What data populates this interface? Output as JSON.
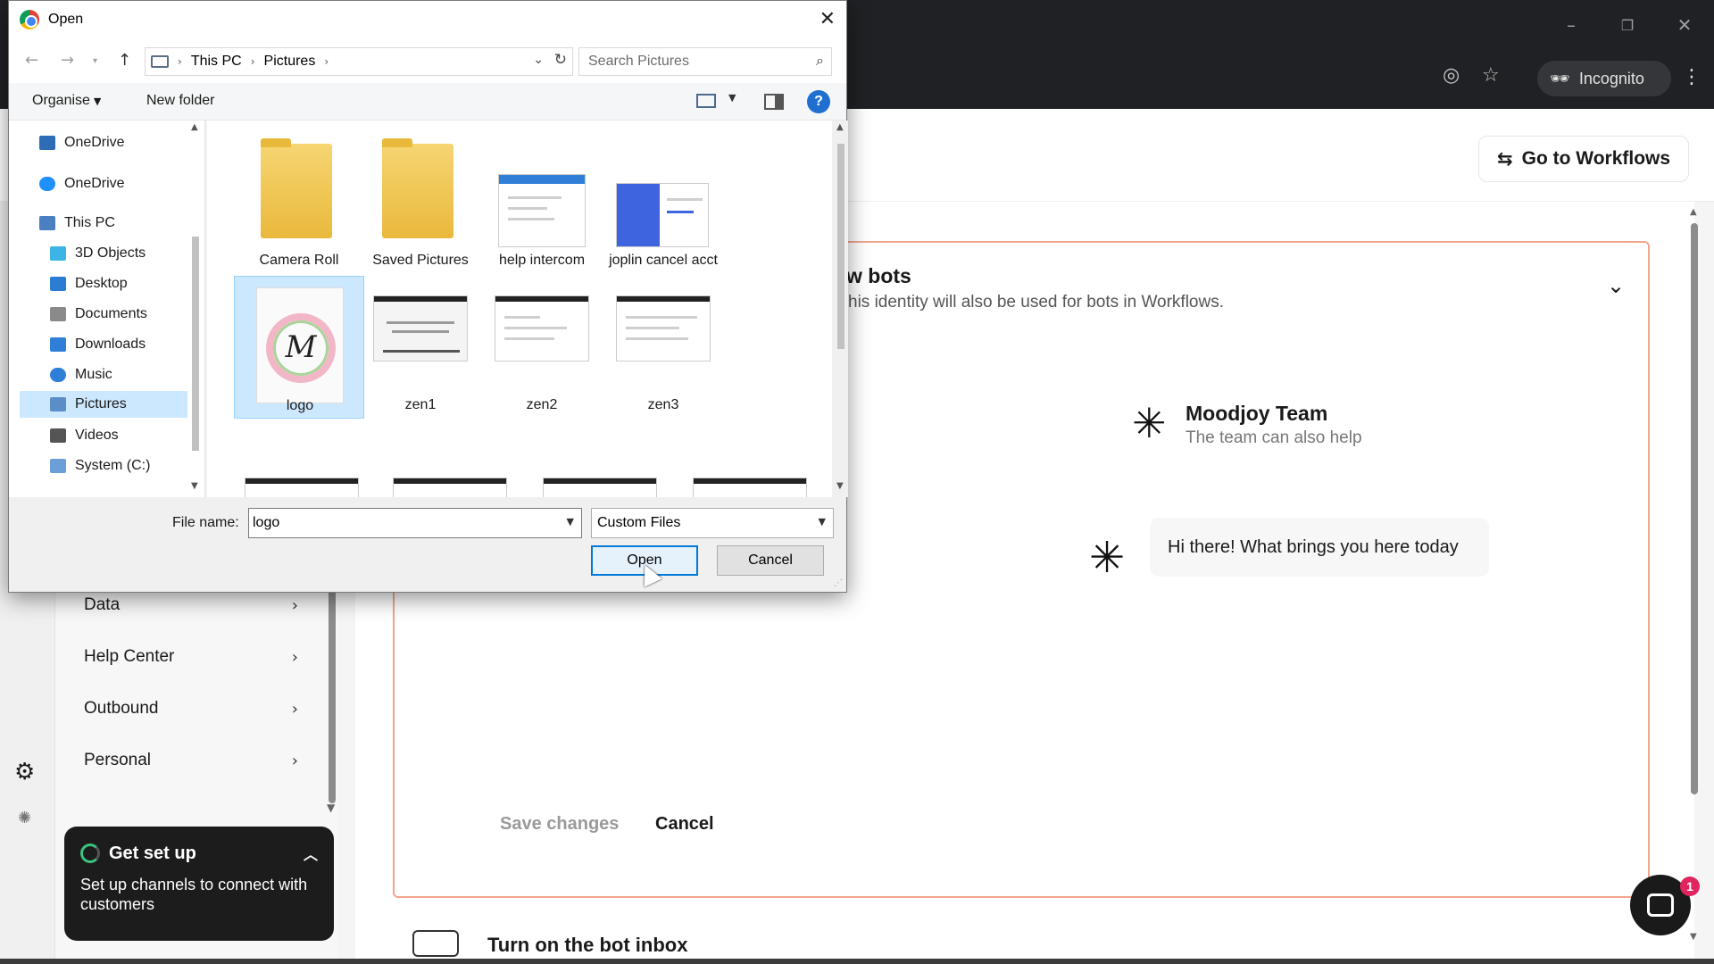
{
  "browser": {
    "minimize_glyph": "–",
    "restore_glyph": "❐",
    "close_glyph": "✕",
    "incognito_label": "Incognito",
    "menu_glyph": "⋮",
    "eye_off_glyph": "◎",
    "star_glyph": "☆"
  },
  "page": {
    "goto_workflows": "Go to Workflows",
    "sidebar": [
      {
        "label": "Data"
      },
      {
        "label": "Help Center"
      },
      {
        "label": "Outbound"
      },
      {
        "label": "Personal"
      }
    ],
    "setup_card": {
      "title": "Get set up",
      "description": "Set up channels to connect with customers"
    },
    "bot_section": {
      "title": "w bots",
      "subtitle": "his identity will also be used for bots in Workflows.",
      "team_name": "Moodjoy Team",
      "team_sub": "The team can also help",
      "greeting": "Hi there! What brings you here today",
      "save_label": "Save changes",
      "cancel_label": "Cancel"
    },
    "next_section_title": "Turn on the bot inbox",
    "chat_badge_count": "1"
  },
  "dialog": {
    "title": "Open",
    "breadcrumb": [
      "This PC",
      "Pictures"
    ],
    "search_placeholder": "Search Pictures",
    "organise_label": "Organise",
    "new_folder_label": "New folder",
    "help_glyph": "?",
    "nav_tree": [
      {
        "label": "OneDrive",
        "color": "#2d6db5"
      },
      {
        "label": "OneDrive",
        "color": "#1e90ff"
      },
      {
        "label": "This PC",
        "color": "#4a7fc1"
      },
      {
        "label": "3D Objects",
        "color": "#3cb4e6"
      },
      {
        "label": "Desktop",
        "color": "#2b7cd3"
      },
      {
        "label": "Documents",
        "color": "#8a8a8a"
      },
      {
        "label": "Downloads",
        "color": "#2f7ed8"
      },
      {
        "label": "Music",
        "color": "#2f7ed8"
      },
      {
        "label": "Pictures",
        "color": "#5b8ec9"
      },
      {
        "label": "Videos",
        "color": "#555555"
      },
      {
        "label": "System (C:)",
        "color": "#6a9fd8"
      }
    ],
    "files": [
      {
        "name": "Camera Roll",
        "kind": "folder"
      },
      {
        "name": "Saved Pictures",
        "kind": "folder"
      },
      {
        "name": "help intercom",
        "kind": "image"
      },
      {
        "name": "joplin cancel acct",
        "kind": "image"
      },
      {
        "name": "logo",
        "kind": "image"
      },
      {
        "name": "zen1",
        "kind": "image"
      },
      {
        "name": "zen2",
        "kind": "image"
      },
      {
        "name": "zen3",
        "kind": "image"
      }
    ],
    "logo_letter": "M",
    "file_name_label": "File name:",
    "file_name_value": "logo",
    "file_type": "Custom Files",
    "open_label": "Open",
    "cancel_label": "Cancel"
  }
}
